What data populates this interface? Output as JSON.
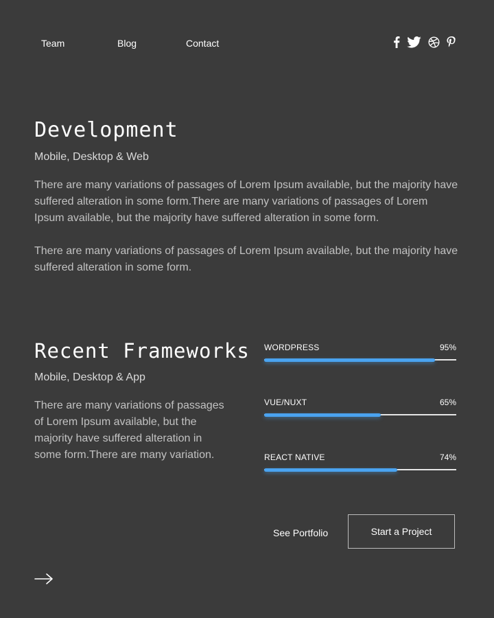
{
  "nav": {
    "links": [
      "Team",
      "Blog",
      "Contact"
    ],
    "social_icons": [
      "facebook-icon",
      "twitter-icon",
      "dribbble-icon",
      "pinterest-icon"
    ]
  },
  "development": {
    "title": "Development",
    "subtitle": "Mobile, Desktop & Web",
    "paragraph_1": "There are many variations of passages of Lorem Ipsum available, but the majority have suffered alteration in some form.There are many variations of passages of Lorem Ipsum available, but the majority have suffered alteration in some form.",
    "paragraph_2": "There are many variations of passages of Lorem Ipsum available, but the majority have suffered alteration in some form."
  },
  "frameworks": {
    "title": "Recent Frameworks",
    "subtitle": "Mobile, Desktop & App",
    "paragraph": "There are many variations of passages of Lorem Ipsum available, but the majority have suffered alteration in some form.There are many variation.",
    "skills": [
      {
        "name": "WORDPRESS",
        "percent_label": "95%",
        "value": 0.95
      },
      {
        "name": "VUE/NUXT",
        "percent_label": "65%",
        "value": 0.65
      },
      {
        "name": "REACT NATIVE",
        "percent_label": "74%",
        "value": 0.74
      }
    ]
  },
  "actions": {
    "portfolio_label": "See Portfolio",
    "project_label": "Start a Project"
  },
  "icons": {
    "next": "arrow-right-icon"
  },
  "colors": {
    "background": "#3b3b3b",
    "accent": "#4aa3f0",
    "track": "#e6e6e6"
  }
}
